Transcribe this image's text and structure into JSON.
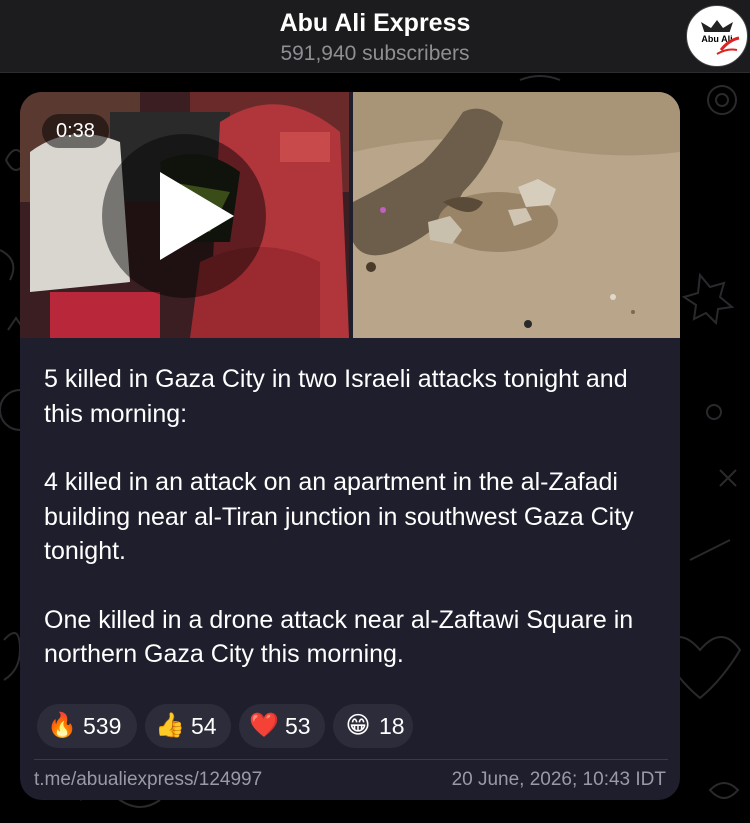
{
  "channel": {
    "title": "Abu Ali Express",
    "subscribers": "591,940 subscribers",
    "avatar_text": "Abu Ali"
  },
  "media": {
    "video_duration": "0:38",
    "play_icon": "play-icon"
  },
  "message": {
    "paragraphs": [
      "5 killed in Gaza City in two Israeli attacks tonight and this morning:",
      "4 killed in an attack on an apartment in the al-Zafadi building near al-Tiran junction in southwest Gaza City tonight.",
      "One killed in a drone attack near al-Zaftawi Square in northern Gaza City this morning."
    ]
  },
  "reactions": [
    {
      "emoji": "🔥",
      "count": "539"
    },
    {
      "emoji": "👍",
      "count": "54"
    },
    {
      "emoji": "❤️",
      "count": "53"
    },
    {
      "emoji": "😁",
      "count": "18"
    }
  ],
  "footer": {
    "link": "t.me/abualiexpress/124997",
    "date": "20 June, 2026; 10:43 IDT"
  },
  "colors": {
    "background": "#000000",
    "header": "#1c1c1e",
    "bubble": "#1e1e2c",
    "reaction_pill": "#2c2c3a",
    "muted_text": "#9a9aa6"
  }
}
